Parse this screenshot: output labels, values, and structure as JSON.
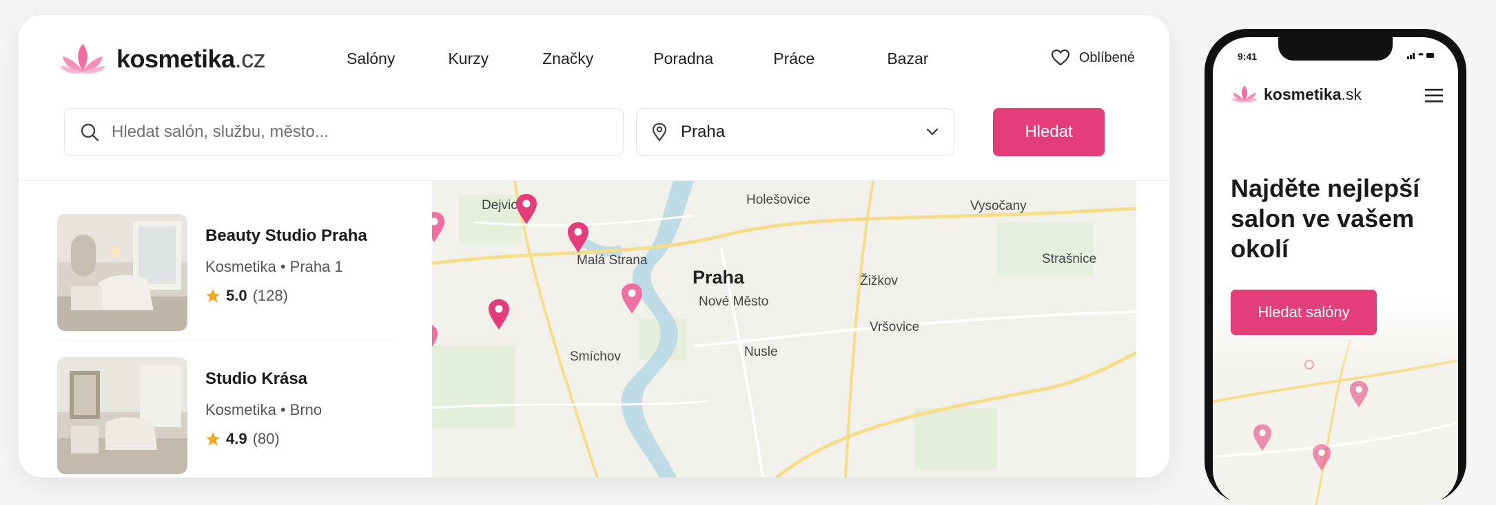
{
  "brand": {
    "name": "kosmetika",
    "tld": ".cz",
    "accent": "#e33d7a"
  },
  "nav": {
    "items": [
      "Salóny",
      "Kurzy",
      "Značky",
      "Poradna",
      "Práce",
      "Bazar"
    ]
  },
  "favorites": {
    "label": "Oblíbené"
  },
  "search": {
    "placeholder": "Hledat salón, službu, město..."
  },
  "location": {
    "value": "Praha"
  },
  "search_button": {
    "label": "Hledat"
  },
  "results": [
    {
      "name": "Beauty Studio Praha",
      "category": "Kosmetika",
      "city": "Praha 1",
      "rating": "5.0",
      "reviews": "(128)"
    },
    {
      "name": "Studio Krása",
      "category": "Kosmetika",
      "city": "Brno",
      "rating": "4.9",
      "reviews": "(80)"
    }
  ],
  "map": {
    "city": "Praha",
    "districts": [
      "Dejvice",
      "Holešovice",
      "Vysočany",
      "Malá Strana",
      "Žižkov",
      "Strašnice",
      "Nové Město",
      "Vršovice",
      "Smíchov",
      "Nusle"
    ]
  },
  "mobile": {
    "time": "9:41",
    "brand": {
      "name": "kosmetika",
      "tld": ".sk"
    },
    "hero_title": "Najděte nejlepší salon ve vašem okolí",
    "cta_label": "Hledat salóny"
  }
}
